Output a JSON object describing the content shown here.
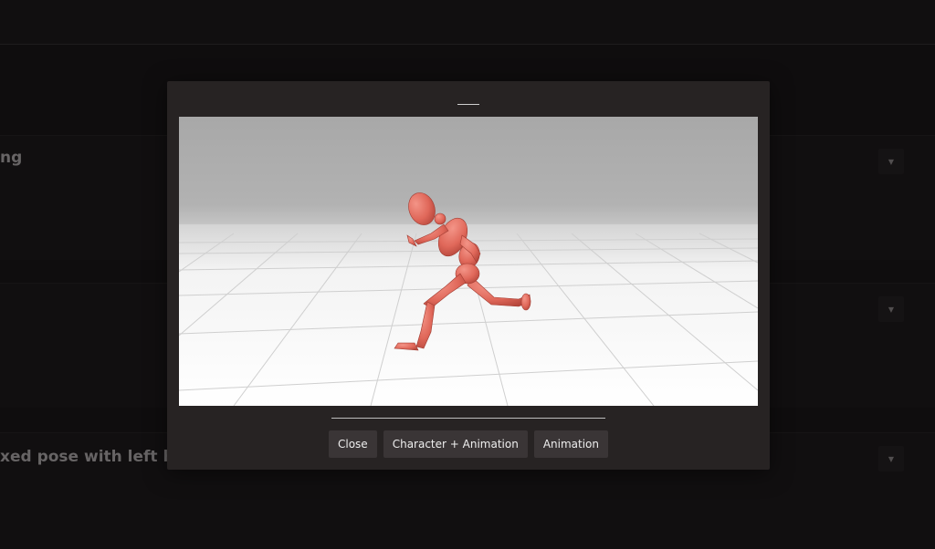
{
  "background": {
    "rows": [
      {
        "title": "ng",
        "dropdown_icon": "caret-down-icon"
      },
      {
        "title": "",
        "dropdown_icon": "caret-down-icon"
      },
      {
        "title": "xed pose with left han",
        "dropdown_icon": "caret-down-icon"
      }
    ]
  },
  "modal": {
    "viewer": {
      "figure_color": "#e0685a",
      "sky_color": "#aaaaaa",
      "floor_color": "#ffffff"
    },
    "buttons": {
      "close": "Close",
      "character_animation": "Character + Animation",
      "animation": "Animation"
    }
  }
}
